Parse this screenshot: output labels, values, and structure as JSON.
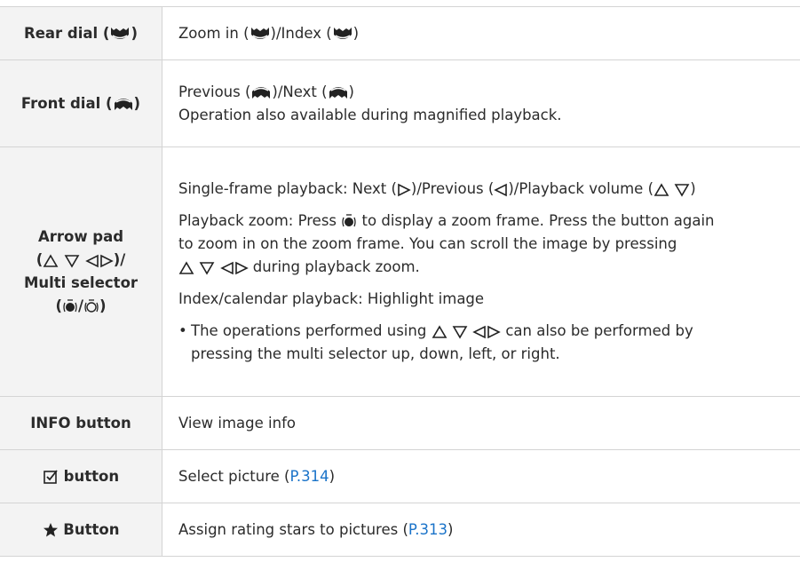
{
  "icons": {
    "rear_dial": "rear-dial-icon",
    "front_dial": "front-dial-icon",
    "arrows": [
      "up-triangle-icon",
      "down-triangle-icon",
      "left-triangle-icon",
      "right-triangle-icon"
    ],
    "multi_press": "multi-selector-press-icon",
    "multi_move": "multi-selector-icon",
    "checkbox": "checkbox-icon",
    "star": "star-icon"
  },
  "colors": {
    "link": "#1a73c9",
    "key_bg": "#f3f3f3",
    "border": "#d4d4d4",
    "text": "#2b2b2b"
  },
  "rows": {
    "rear_dial": {
      "key_label": "Rear dial (",
      "key_close": ")",
      "desc": {
        "part1": "Zoom in (",
        "part2": ")/Index (",
        "part3": ")"
      }
    },
    "front_dial": {
      "key_label": "Front dial (",
      "key_close": ")",
      "desc_line1": {
        "part1": "Previous (",
        "part2": ")/Next (",
        "part3": ")"
      },
      "desc_line2": "Operation also available during magnified playback."
    },
    "arrow_pad": {
      "key_line1": "Arrow pad",
      "key_line2_open": "(",
      "key_line2_close": ")/",
      "key_line3": "Multi selector",
      "key_line4_open": "(",
      "key_line4_sep": "/",
      "key_line4_close": ")",
      "single_frame": {
        "part1": "Single-frame playback: Next (",
        "part2": ")/Previous (",
        "part3": ")/Playback volume (",
        "part4": ")"
      },
      "playback_zoom": {
        "part1": "Playback zoom: Press",
        "part2": "to display a zoom frame. Press the button again",
        "line2": "to zoom in on the zoom frame. You can scroll the image by pressing",
        "line3_tail": "during playback zoom."
      },
      "index_calendar": "Index/calendar playback: Highlight image",
      "bullet": {
        "dot": "•",
        "part1": "The operations performed using",
        "part2": "can also be performed by",
        "line2": "pressing the multi selector up, down, left, or right."
      }
    },
    "info_button": {
      "key_bold": "INFO",
      "key_rest": " button",
      "desc": "View image info"
    },
    "select_button": {
      "key_rest": "button",
      "desc": "Select picture (",
      "link": "P.314",
      "desc_close": ")"
    },
    "rating_button": {
      "key_rest": "Button",
      "desc": "Assign rating stars to pictures (",
      "link": "P.313",
      "desc_close": ")"
    }
  }
}
